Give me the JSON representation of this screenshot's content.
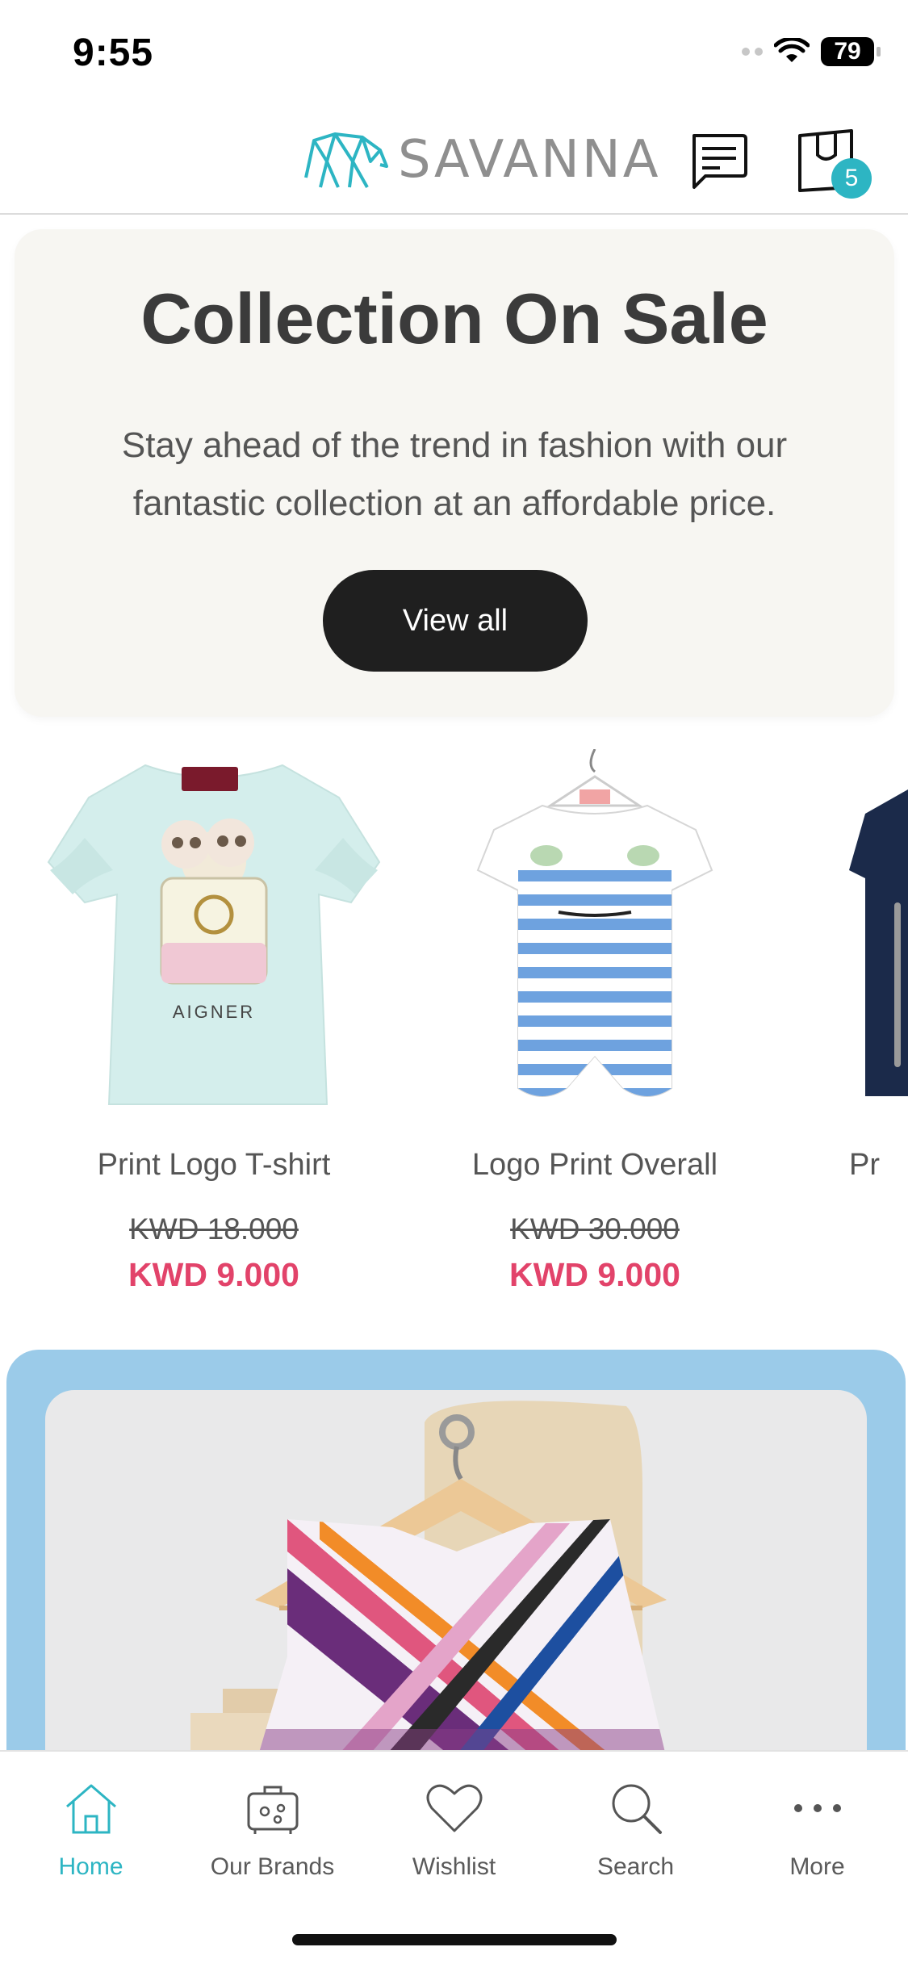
{
  "status_bar": {
    "time": "9:55",
    "battery": "79"
  },
  "header": {
    "logo_text": "SAVANNA",
    "cart_count": "5",
    "brand_color": "#2db5c3"
  },
  "promo": {
    "title": "Collection On Sale",
    "text": "Stay ahead of the trend in fashion with our fantastic collection at an affordable price.",
    "button_label": "View all"
  },
  "products": [
    {
      "name": "Print Logo T-shirt",
      "old_price": "KWD 18.000",
      "new_price": "KWD 9.000",
      "print_text": "AIGNER"
    },
    {
      "name": "Logo Print Overall",
      "old_price": "KWD 30.000",
      "new_price": "KWD 9.000"
    },
    {
      "name": "Pr"
    }
  ],
  "sale_color": "#e2436a",
  "bottom_nav": [
    {
      "label": "Home",
      "icon": "home-icon",
      "active": true
    },
    {
      "label": "Our Brands",
      "icon": "brands-icon",
      "active": false
    },
    {
      "label": "Wishlist",
      "icon": "heart-icon",
      "active": false
    },
    {
      "label": "Search",
      "icon": "search-icon",
      "active": false
    },
    {
      "label": "More",
      "icon": "more-icon",
      "active": false
    }
  ]
}
